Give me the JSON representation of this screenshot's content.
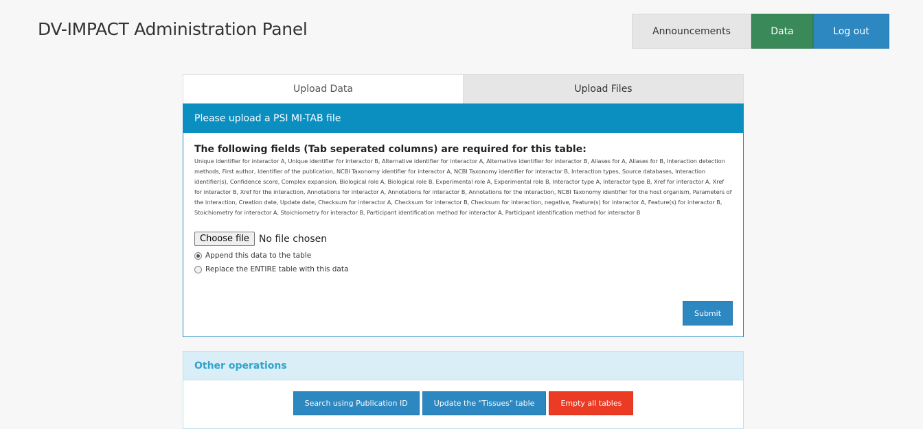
{
  "header": {
    "title": "DV-IMPACT Administration Panel",
    "nav": {
      "announcements": "Announcements",
      "data": "Data",
      "logout": "Log out"
    }
  },
  "tabs": {
    "upload_data": "Upload Data",
    "upload_files": "Upload Files"
  },
  "upload_panel": {
    "header": "Please upload a PSI MI-TAB file",
    "fields_title": "The following fields (Tab seperated columns) are required for this table:",
    "fields_list": "Unique identifier for interactor A, Unique identifier for interactor B, Alternative identifier for interactor A, Alternative identifier for interactor B, Aliases for A, Aliases for B, Interaction detection methods, First author, Identifier of the publication, NCBI Taxonomy identifier for interactor A, NCBI Taxonomy identifier for interactor B, Interaction types, Source databases, Interaction identifier(s), Confidence score, Complex expansion, Biological role A, Biological role B, Experimental role A, Experimental role B, Interactor type A, Interactor type B, Xref for interactor A, Xref for interactor B, Xref for the interaction, Annotations for interactor A, Annotations for interactor B, Annotations for the interaction, NCBI Taxonomy identifier for the host organism, Parameters of the interaction, Creation date, Update date, Checksum for interactor A, Checksum for interactor B, Checksum for interaction, negative, Feature(s) for interactor A, Feature(s) for interactor B, Stoichiometry for interactor A, Stoichiometry for interactor B, Participant identification method for interactor A, Participant identification method for interactor B",
    "choose_file": "Choose file",
    "no_file": "No file chosen",
    "radio_append": "Append this data to the table",
    "radio_replace": "Replace the ENTIRE table with this data",
    "selected_option": "append",
    "submit": "Submit"
  },
  "other_operations": {
    "header": "Other operations",
    "search": "Search using Publication ID",
    "update_tissues": "Update the \"Tissues\" table",
    "empty_tables": "Empty all tables"
  },
  "colors": {
    "primary": "#2d87c0",
    "success": "#3a8a59",
    "danger": "#ec3b25",
    "panel_header": "#0b8fc1"
  }
}
